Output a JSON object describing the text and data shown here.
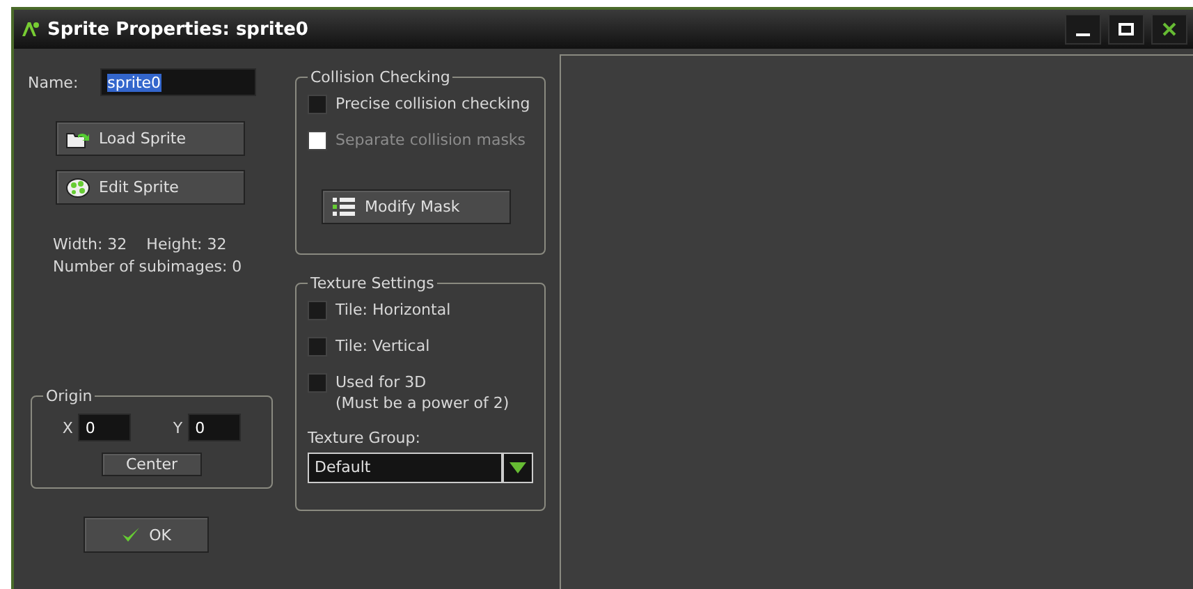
{
  "window": {
    "title": "Sprite Properties: sprite0"
  },
  "name_field": {
    "label": "Name:",
    "value": "sprite0"
  },
  "buttons": [
    {
      "kind": "load",
      "label": "Load Sprite"
    },
    {
      "kind": "edit",
      "label": "Edit Sprite"
    }
  ],
  "info": {
    "width": "Width: 32",
    "height": "Height: 32",
    "subimages": "Number of subimages: 0"
  },
  "origin": {
    "title": "Origin",
    "x_label": "X",
    "x_value": "0",
    "y_label": "Y",
    "y_value": "0",
    "center_button": "Center"
  },
  "ok_button": "OK",
  "collision": {
    "title": "Collision Checking",
    "options": [
      {
        "label": "Precise collision checking",
        "checked": false,
        "disabled": false
      },
      {
        "label": "Separate collision masks",
        "checked": false,
        "disabled": true
      }
    ],
    "modify_button": "Modify Mask"
  },
  "texture": {
    "title": "Texture Settings",
    "options": [
      {
        "label": "Tile: Horizontal",
        "checked": false
      },
      {
        "label": "Tile: Vertical",
        "checked": false
      },
      {
        "label": "Used for 3D",
        "note": "(Must be a power of 2)",
        "checked": false
      }
    ],
    "group_label": "Texture Group:",
    "group_value": "Default"
  }
}
